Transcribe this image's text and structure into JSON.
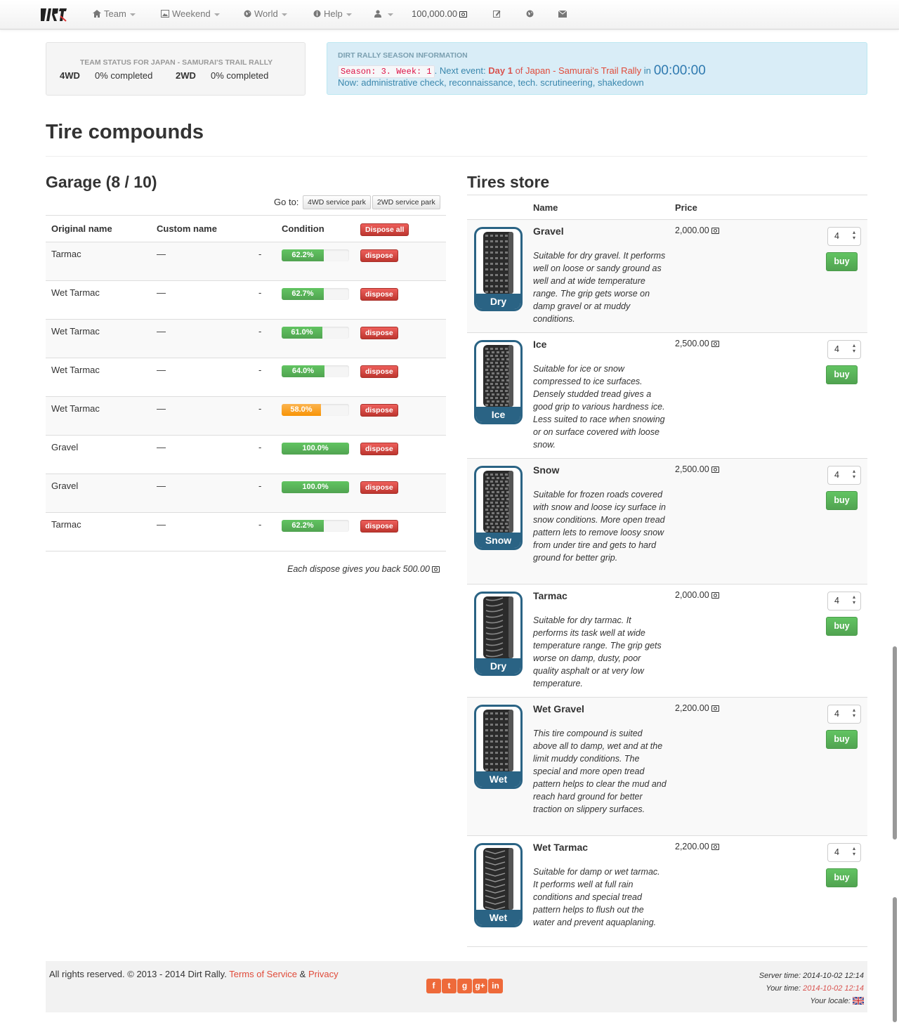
{
  "nav": {
    "team": "Team",
    "weekend": "Weekend",
    "world": "World",
    "help": "Help",
    "balance": "100,000.00"
  },
  "status": {
    "title": "TEAM STATUS FOR JAPAN - SAMURAI'S TRAIL RALLY",
    "a_label": "4WD",
    "a_value": "0% completed",
    "b_label": "2WD",
    "b_value": "0% completed"
  },
  "season": {
    "title": "DIRT RALLY SEASON INFORMATION",
    "code": "Season: 3. Week: 1",
    "next_prefix": ". Next event:",
    "day": "Day 1",
    "of": "of",
    "event": "Japan - Samurai's Trail Rally",
    "in": "in",
    "countdown": "00:00:00",
    "now": "Now: administrative check, reconnaissance, tech. scrutineering, shakedown"
  },
  "page": {
    "title": "Tire compounds"
  },
  "garage": {
    "title": "Garage (8 / 10)",
    "goto_label": "Go to:",
    "btn_4wd": "4WD service park",
    "btn_2wd": "2WD service park",
    "headers": {
      "original": "Original name",
      "custom": "Custom name",
      "condition": "Condition",
      "dispose_all": "Dispose all"
    },
    "rows": [
      {
        "name": "Tarmac",
        "custom": "—",
        "dash": "-",
        "cond": "62.2%",
        "level": 0.622,
        "btn": "dispose"
      },
      {
        "name": "Wet Tarmac",
        "custom": "—",
        "dash": "-",
        "cond": "62.7%",
        "level": 0.627,
        "btn": "dispose"
      },
      {
        "name": "Wet Tarmac",
        "custom": "—",
        "dash": "-",
        "cond": "61.0%",
        "level": 0.61,
        "btn": "dispose"
      },
      {
        "name": "Wet Tarmac",
        "custom": "—",
        "dash": "-",
        "cond": "64.0%",
        "level": 0.64,
        "btn": "dispose"
      },
      {
        "name": "Wet Tarmac",
        "custom": "—",
        "dash": "-",
        "cond": "58.0%",
        "level": 0.58,
        "btn": "dispose",
        "warn": true
      },
      {
        "name": "Gravel",
        "custom": "—",
        "dash": "-",
        "cond": "100.0%",
        "level": 1.0,
        "btn": "dispose"
      },
      {
        "name": "Gravel",
        "custom": "—",
        "dash": "-",
        "cond": "100.0%",
        "level": 1.0,
        "btn": "dispose"
      },
      {
        "name": "Tarmac",
        "custom": "—",
        "dash": "-",
        "cond": "62.2%",
        "level": 0.622,
        "btn": "dispose"
      }
    ],
    "note": "Each dispose gives you back 500.00"
  },
  "store": {
    "title": "Tires store",
    "headers": {
      "name": "Name",
      "price": "Price"
    },
    "items": [
      {
        "name": "Gravel",
        "badge": "Dry",
        "price": "2,000.00",
        "qty": "4",
        "buy": "buy",
        "desc": "Suitable for dry gravel. It performs well on loose or sandy ground as well and at wide temperature range. The grip gets worse on damp gravel or at muddy conditions."
      },
      {
        "name": "Ice",
        "badge": "Ice",
        "price": "2,500.00",
        "qty": "4",
        "buy": "buy",
        "desc": "Suitable for ice or snow compressed to ice surfaces. Densely studded tread gives a good grip to various hardness ice. Less suited to race when snowing or on surface covered with loose snow."
      },
      {
        "name": "Snow",
        "badge": "Snow",
        "price": "2,500.00",
        "qty": "4",
        "buy": "buy",
        "desc": "Suitable for frozen roads covered with snow and loose icy surface in snow conditions. More open tread pattern lets to remove loosy snow from under tire and gets to hard ground for better grip."
      },
      {
        "name": "Tarmac",
        "badge": "Dry",
        "price": "2,000.00",
        "qty": "4",
        "buy": "buy",
        "desc": "Suitable for dry tarmac. It performs its task well at wide temperature range. The grip gets worse on damp, dusty, poor quality asphalt or at very low temperature."
      },
      {
        "name": "Wet Gravel",
        "badge": "Wet",
        "price": "2,200.00",
        "qty": "4",
        "buy": "buy",
        "desc": "This tire compound is suited above all to damp, wet and at the limit muddy conditions. The special and more open tread pattern helps to clear the mud and reach hard ground for better traction on slippery surfaces."
      },
      {
        "name": "Wet Tarmac",
        "badge": "Wet",
        "price": "2,200.00",
        "qty": "4",
        "buy": "buy",
        "desc": "Suitable for damp or wet tarmac. It performs well at full rain conditions and special tread pattern helps to flush out the water and prevent aquaplaning."
      }
    ]
  },
  "footer": {
    "rights": "All rights reserved. © 2013 - 2014 Dirt Rally.",
    "tos": "Terms of Service",
    "amp": "&",
    "privacy": "Privacy",
    "server_label": "Server time:",
    "server_time": "2014-10-02 12:14",
    "your_label": "Your time:",
    "your_time": "2014-10-02 12:14",
    "locale_label": "Your locale:"
  }
}
